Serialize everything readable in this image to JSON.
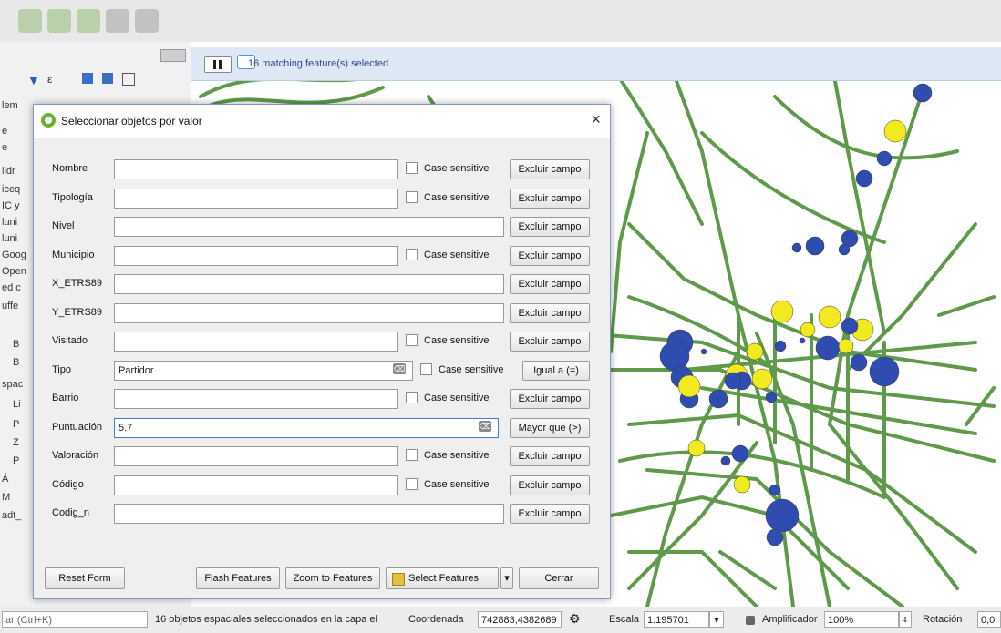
{
  "message_bar": {
    "text": "16 matching feature(s) selected"
  },
  "left_panel": {
    "fragments": [
      "lem",
      "e",
      "e",
      "lidr",
      "iceq",
      "IC y",
      "luni",
      "luni",
      "Goog",
      "Open",
      "ed c",
      "uffe",
      "B",
      "B",
      "spac",
      "Li",
      "P",
      "Z",
      "P",
      "Á",
      "M",
      "adt_"
    ]
  },
  "dialog": {
    "title": "Seleccionar objetos por valor",
    "close_icon": "×",
    "fields": [
      {
        "label": "Nombre",
        "value": "",
        "case_sensitive": "Case sensitive",
        "button": "Excluir campo"
      },
      {
        "label": "Tipología",
        "value": "",
        "case_sensitive": "Case sensitive",
        "button": "Excluir campo"
      },
      {
        "label": "Nivel",
        "value": "",
        "case_sensitive": "",
        "button": "Excluir campo"
      },
      {
        "label": "Municipio",
        "value": "",
        "case_sensitive": "Case sensitive",
        "button": "Excluir campo"
      },
      {
        "label": "X_ETRS89",
        "value": "",
        "case_sensitive": "",
        "button": "Excluir campo"
      },
      {
        "label": "Y_ETRS89",
        "value": "",
        "case_sensitive": "",
        "button": "Excluir campo"
      },
      {
        "label": "Visitado",
        "value": "",
        "case_sensitive": "Case sensitive",
        "button": "Excluir campo"
      },
      {
        "label": "Tipo",
        "value": "Partidor",
        "case_sensitive": "Case sensitive",
        "button": "Igual a (=)"
      },
      {
        "label": "Barrio",
        "value": "",
        "case_sensitive": "Case sensitive",
        "button": "Excluir campo"
      },
      {
        "label": "Puntuación",
        "value": "5.7",
        "case_sensitive": "",
        "button": "Mayor que (>)"
      },
      {
        "label": "Valoración",
        "value": "",
        "case_sensitive": "Case sensitive",
        "button": "Excluir campo"
      },
      {
        "label": "Código",
        "value": "",
        "case_sensitive": "Case sensitive",
        "button": "Excluir campo"
      },
      {
        "label": "Codig_n",
        "value": "",
        "case_sensitive": "",
        "button": "Excluir campo"
      }
    ],
    "buttons": {
      "reset": "Reset Form",
      "flash": "Flash Features",
      "zoom": "Zoom to Features",
      "select": "Select Features",
      "select_dropdown": "▾",
      "close": "Cerrar"
    }
  },
  "status_bar": {
    "search_placeholder": "ar (Ctrl+K)",
    "message": "16 objetos espaciales seleccionados en la capa el",
    "coord_label": "Coordenada",
    "coord_value": "742883,4382689",
    "scale_label": "Escala",
    "scale_value": "1:195701",
    "magnifier_label": "Amplificador",
    "magnifier_value": "100%",
    "rotation_label": "Rotación",
    "rotation_value": "0,0"
  },
  "colors": {
    "road": "#5f9a4a",
    "point_blue": "#2f4db0",
    "point_yellow": "#f0ea1e",
    "accent": "#3b7fd9"
  },
  "icons": [
    "qgis-logo-icon",
    "close-icon",
    "clear-icon",
    "dropdown-arrow-icon",
    "message-icon",
    "lock-icon",
    "stepper-icon"
  ]
}
